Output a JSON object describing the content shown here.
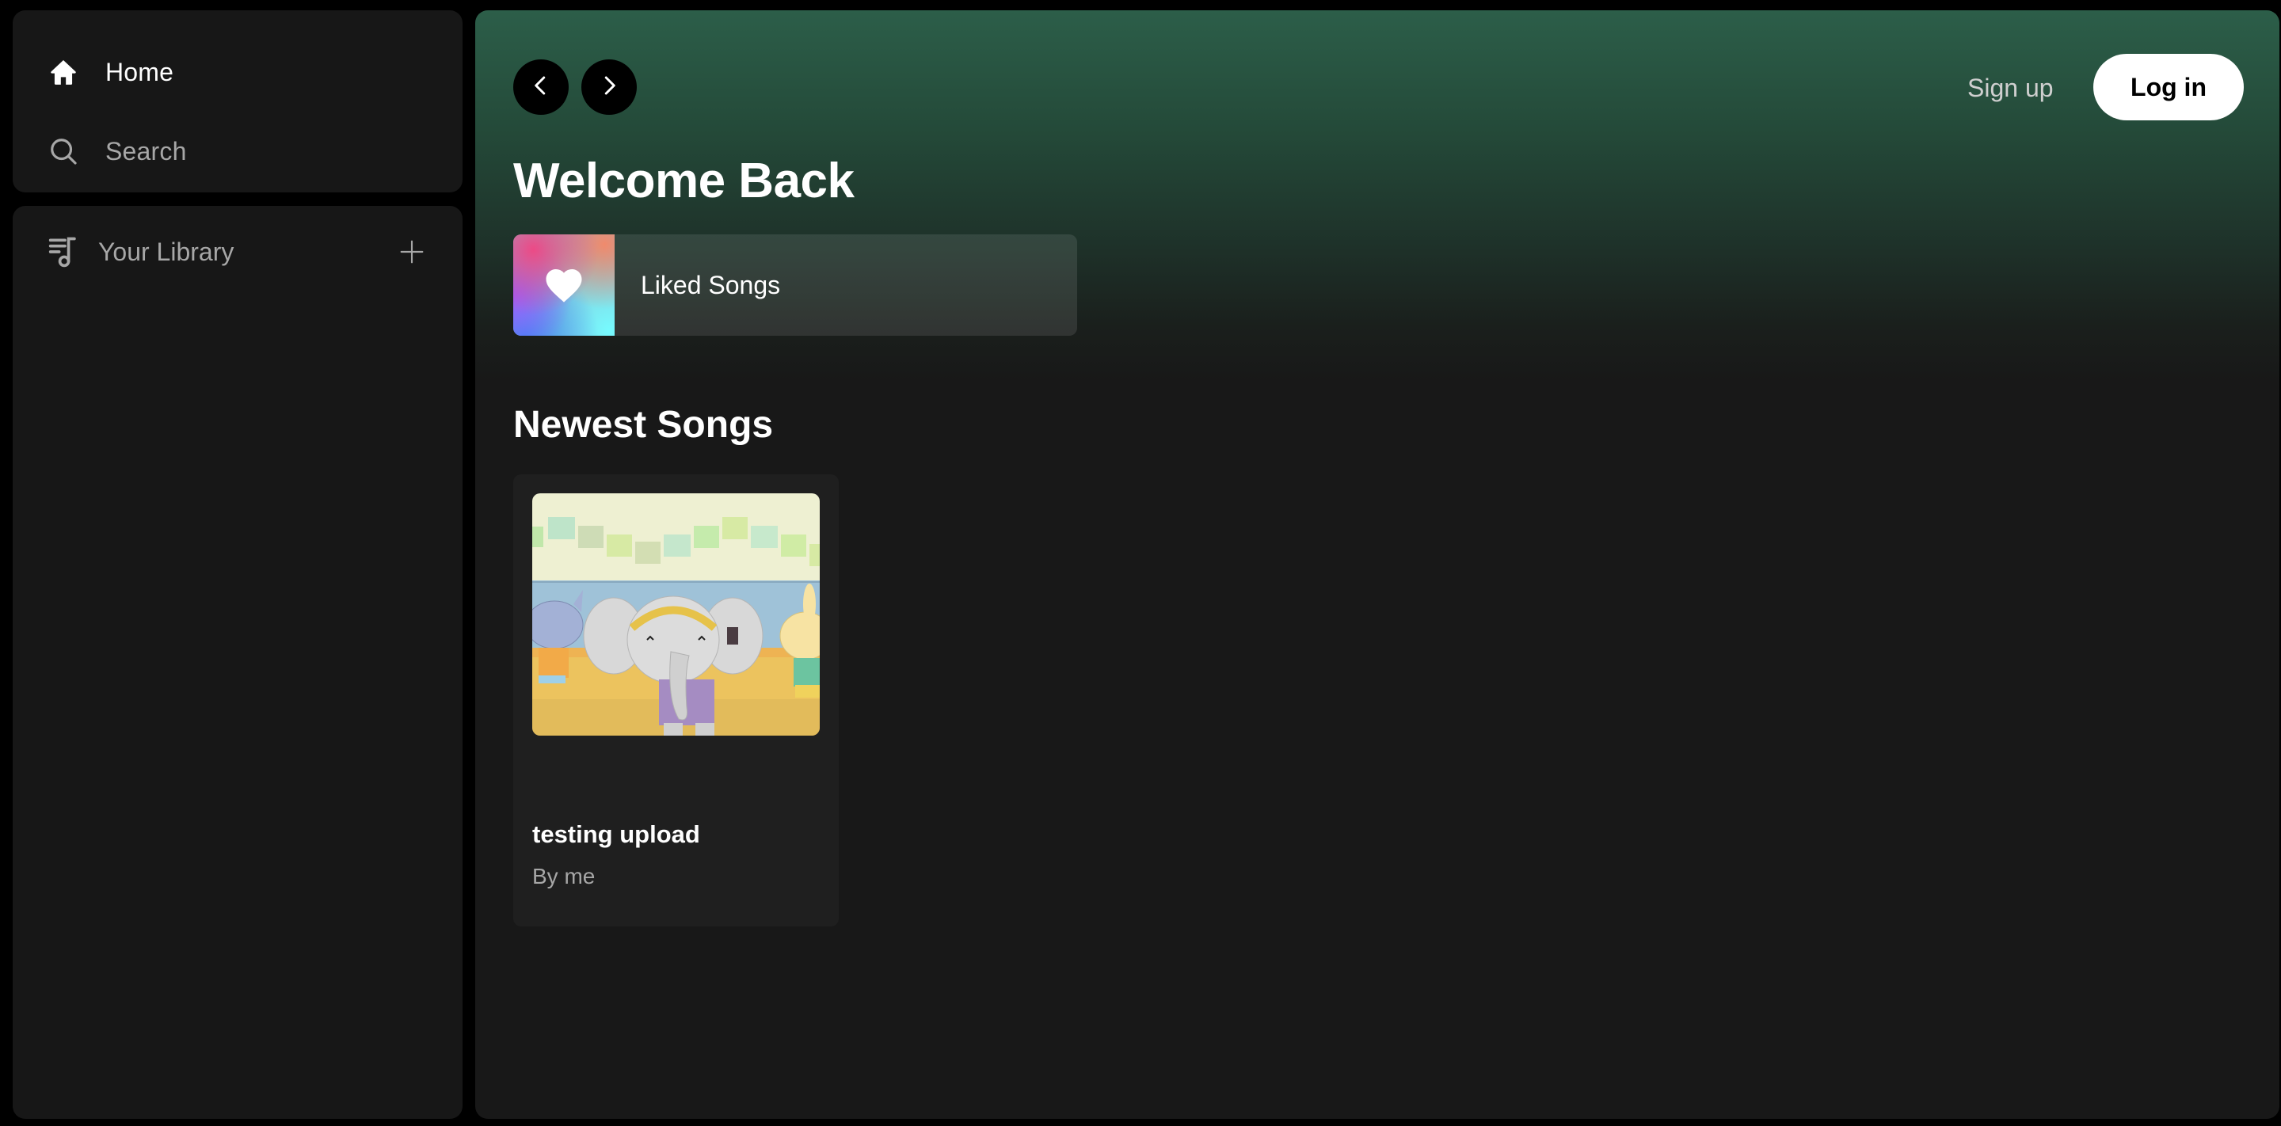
{
  "sidebar": {
    "nav": [
      {
        "label": "Home",
        "icon": "home-icon",
        "active": true
      },
      {
        "label": "Search",
        "icon": "search-icon",
        "active": false
      }
    ],
    "library": {
      "label": "Your Library",
      "icon": "library-icon",
      "add_icon": "plus-icon"
    }
  },
  "header": {
    "back_icon": "chevron-left-icon",
    "forward_icon": "chevron-right-icon",
    "signup_label": "Sign up",
    "login_label": "Log in"
  },
  "main": {
    "welcome_title": "Welcome Back",
    "liked_songs": {
      "label": "Liked Songs",
      "icon": "heart-icon"
    },
    "newest_title": "Newest Songs",
    "songs": [
      {
        "title": "testing upload",
        "artist": "By me",
        "artwork": "cartoon elephant, cat and bunny illustration"
      }
    ]
  },
  "colors": {
    "background": "#000000",
    "panel": "#171717",
    "header_gradient_top": "#2c5e49",
    "main_bg": "#181818",
    "card_bg": "#1f1f1f",
    "muted_text": "#a7a7a7",
    "text": "#ffffff"
  }
}
